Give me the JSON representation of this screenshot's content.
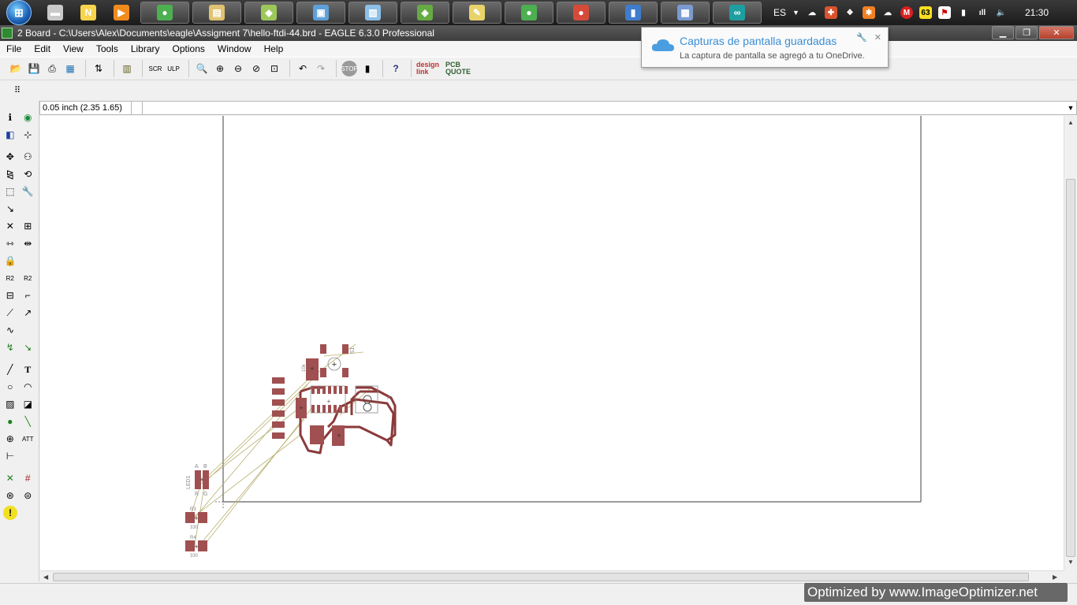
{
  "taskbar": {
    "apps": [
      {
        "name": "files-app",
        "glyph": "▬",
        "color": "#c9c9c9"
      },
      {
        "name": "notepad-plus-app",
        "glyph": "N",
        "color": "#f7d44c"
      },
      {
        "name": "media-app",
        "glyph": "▶",
        "color": "#f28b1e"
      },
      {
        "name": "chrome-app",
        "glyph": "●",
        "color": "#4caf50"
      },
      {
        "name": "explorer-app",
        "glyph": "▤",
        "color": "#e0c270"
      },
      {
        "name": "paint-app",
        "glyph": "◆",
        "color": "#9ec75a"
      },
      {
        "name": "remote-app",
        "glyph": "▣",
        "color": "#5ea0d8"
      },
      {
        "name": "docs-app",
        "glyph": "▥",
        "color": "#8cc0e6"
      },
      {
        "name": "git-app",
        "glyph": "◈",
        "color": "#66aa44"
      },
      {
        "name": "notes-app",
        "glyph": "✎",
        "color": "#e8d36a"
      },
      {
        "name": "chrome-app-2",
        "glyph": "●",
        "color": "#4caf50"
      },
      {
        "name": "flash-app",
        "glyph": "●",
        "color": "#d64a3a"
      },
      {
        "name": "inkscape-app",
        "glyph": "▮",
        "color": "#3f7ccc"
      },
      {
        "name": "eagle-app",
        "glyph": "▦",
        "color": "#7b9bd0"
      },
      {
        "name": "arduino-app",
        "glyph": "∞",
        "color": "#1f9ea0"
      }
    ],
    "tray": {
      "language": "ES",
      "badge_count": "63",
      "clock": "21:30"
    }
  },
  "window": {
    "title": "2 Board - C:\\Users\\Alex\\Documents\\eagle\\Assigment 7\\hello-ftdi-44.brd - EAGLE 6.3.0 Professional",
    "min_label": "▁",
    "max_label": "❐",
    "close_label": "✕"
  },
  "menu": [
    "File",
    "Edit",
    "View",
    "Tools",
    "Library",
    "Options",
    "Window",
    "Help"
  ],
  "toolbar": {
    "designlink": "design\nlink",
    "pcb_quote": "PCB\nQUOTE"
  },
  "command": {
    "coordinate": "0.05 inch (2.35 1.65)",
    "value": ""
  },
  "notification": {
    "title": "Capturas de pantalla guardadas",
    "body": "La captura de pantalla se agregó a tu OneDrive."
  },
  "board": {
    "labels": {
      "led": "LED1",
      "led_a": "A",
      "led_b": "B",
      "led_r": "R",
      "led_g": "G",
      "r3": "R3",
      "r3_val": "330",
      "r4": "R4",
      "r4_val": "330",
      "s1": "S1",
      "r10": "10k"
    },
    "colors": {
      "pad": "#a05050",
      "trace": "#8b3a3a",
      "airwire": "#b8b070",
      "outline": "#606060"
    }
  },
  "watermark": "Optimized by www.ImageOptimizer.net"
}
